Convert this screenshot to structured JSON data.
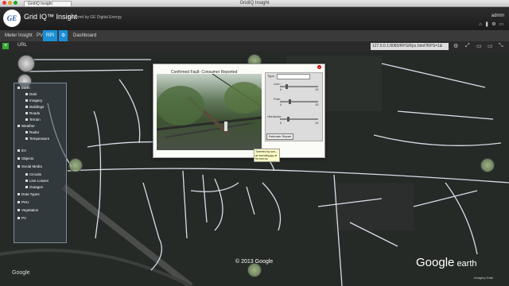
{
  "browser": {
    "title": "GridIQ Insight",
    "tab_label": "GridIQ Insight"
  },
  "app": {
    "logo_text": "GE",
    "title": "Grid IQ™ Insight",
    "subtitle": "powered by GE Digital Energy",
    "user": "admin",
    "user_icons": "⌂ ❚ ⚙ ▭"
  },
  "nav": {
    "items": [
      "Meter Insight",
      "PV",
      "RPI",
      "Dashboard"
    ],
    "active_index": 2,
    "gear_icon": "⚙"
  },
  "urlbar": {
    "add_icon": "+",
    "label": "URL",
    "url": "127.0.0.1:8080/RPS/Rps.html?RPS=1&",
    "tool_icons": [
      "⚙",
      "⤢",
      "▭",
      "▭",
      "⤡"
    ]
  },
  "sidebar": {
    "tree": [
      {
        "label": "Earth",
        "level": 0
      },
      {
        "label": "Dark",
        "level": 1
      },
      {
        "label": "Imagery",
        "level": 1
      },
      {
        "label": "Buildings",
        "level": 1
      },
      {
        "label": "Roads",
        "level": 1
      },
      {
        "label": "Terrain",
        "level": 1
      },
      {
        "label": "Weather",
        "level": 0
      },
      {
        "label": "Radar",
        "level": 1
      },
      {
        "label": "Temperature",
        "level": 1
      },
      {
        "label": "EV",
        "level": 0
      },
      {
        "label": "Objects",
        "level": 0
      },
      {
        "label": "Social Media",
        "level": 0
      },
      {
        "label": "Circuits",
        "level": 1
      },
      {
        "label": "Line Losses",
        "level": 1
      },
      {
        "label": "Outages",
        "level": 1
      },
      {
        "label": "Data Types",
        "level": 0
      },
      {
        "label": "PHU",
        "level": 0
      },
      {
        "label": "Vegetation",
        "level": 0
      },
      {
        "label": "PV",
        "level": 0
      }
    ]
  },
  "popup": {
    "close": "x",
    "caption": "Confirmed Fault: Consumer Reported",
    "type_label": "Type:",
    "sliders": [
      {
        "label": "Line:",
        "min": "0",
        "max": "10",
        "level": 0.15
      },
      {
        "label": "Pole:",
        "min": "0",
        "max": "10",
        "level": 0.25
      },
      {
        "label": "Hardware:",
        "min": "0",
        "max": "10",
        "level": 0.2
      }
    ],
    "estimate_button": "Estimate Repair",
    "tooltip": "Tweeted by sos... at mm/dd/yyyy at hh:mm:ss"
  },
  "map": {
    "copyright": "© 2013 Google",
    "brand": "Google",
    "brand_suffix": "earth",
    "google_logo": "Google",
    "bottom_right": "Imagery Date"
  }
}
